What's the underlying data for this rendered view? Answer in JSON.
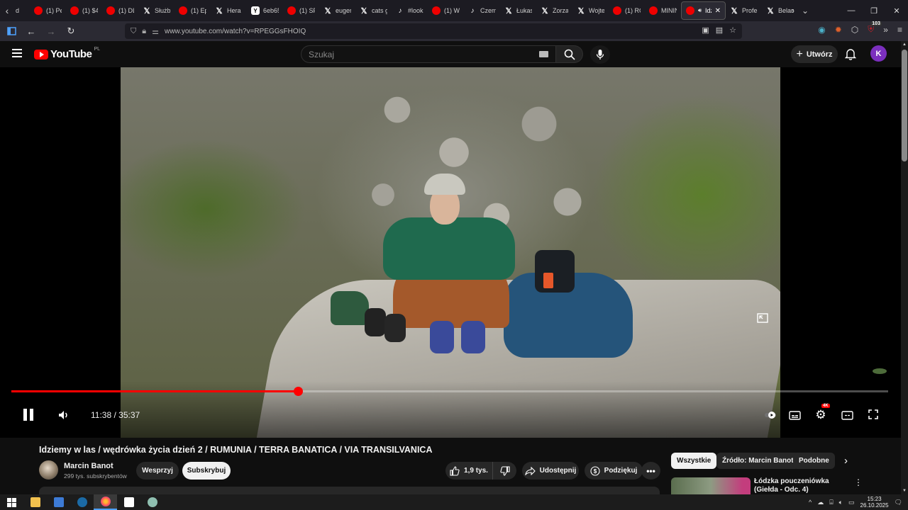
{
  "browser": {
    "tabs": [
      {
        "label": "(1) Pe",
        "icon": "youtube-icon"
      },
      {
        "label": "(1) $4",
        "icon": "youtube-icon"
      },
      {
        "label": "(1) DL",
        "icon": "youtube-icon"
      },
      {
        "label": "Służb",
        "icon": "x-icon"
      },
      {
        "label": "(1) Ep",
        "icon": "youtube-icon"
      },
      {
        "label": "Hera",
        "icon": "x-icon"
      },
      {
        "label": "6eb65",
        "icon": "y-icon"
      },
      {
        "label": "(1) SP",
        "icon": "youtube-icon"
      },
      {
        "label": "euger",
        "icon": "x-icon"
      },
      {
        "label": "cats g",
        "icon": "x-icon"
      },
      {
        "label": "#look",
        "icon": "tiktok-icon"
      },
      {
        "label": "(1) W",
        "icon": "youtube-icon"
      },
      {
        "label": "Czem",
        "icon": "tiktok-icon"
      },
      {
        "label": "Łukas",
        "icon": "x-icon"
      },
      {
        "label": "Zorza",
        "icon": "x-icon"
      },
      {
        "label": "Wojte",
        "icon": "x-icon"
      },
      {
        "label": "(1) RC",
        "icon": "youtube-icon"
      },
      {
        "label": "MININ",
        "icon": "youtube-icon"
      },
      {
        "label": "Idz",
        "icon": "youtube-icon",
        "active": true
      },
      {
        "label": "Profe",
        "icon": "x-icon"
      },
      {
        "label": "Belan",
        "icon": "x-icon"
      }
    ],
    "first_tab_partial": "d",
    "url": "www.youtube.com/watch?v=RPEGGsFHOIQ",
    "extension_badge": "103"
  },
  "masthead": {
    "logo_text": "YouTube",
    "country_code": "PL",
    "search_placeholder": "Szukaj",
    "create_label": "Utwórz",
    "avatar_letter": "K",
    "avatar_color": "#7b2fbe"
  },
  "player": {
    "current_time": "11:38",
    "duration": "35:37",
    "time_display": "11:38 / 35:37",
    "progress_fraction": 0.3266,
    "quality_badge": "4K",
    "accent_color": "#ff0000"
  },
  "video": {
    "title": "Idziemy w las / wędrówka życia dzień 2 / RUMUNIA / TERRA BANATICA / VIA TRANSILVANICA",
    "channel_name": "Marcin Banot",
    "subscribers": "299 tys. subskrybentów",
    "support_label": "Wesprzyj",
    "subscribe_label": "Subskrybuj",
    "likes": "1,9 tys.",
    "share_label": "Udostępnij",
    "thanks_label": "Podziękuj"
  },
  "sidebar": {
    "chips": [
      "Wszystkie",
      "Źródło: Marcin Banot",
      "Podobne"
    ],
    "recommendation_title": "Łódzka pouczeniówka (Giełda - Odc. 4)"
  },
  "taskbar": {
    "time": "15:23",
    "date": "26.10.2025"
  }
}
